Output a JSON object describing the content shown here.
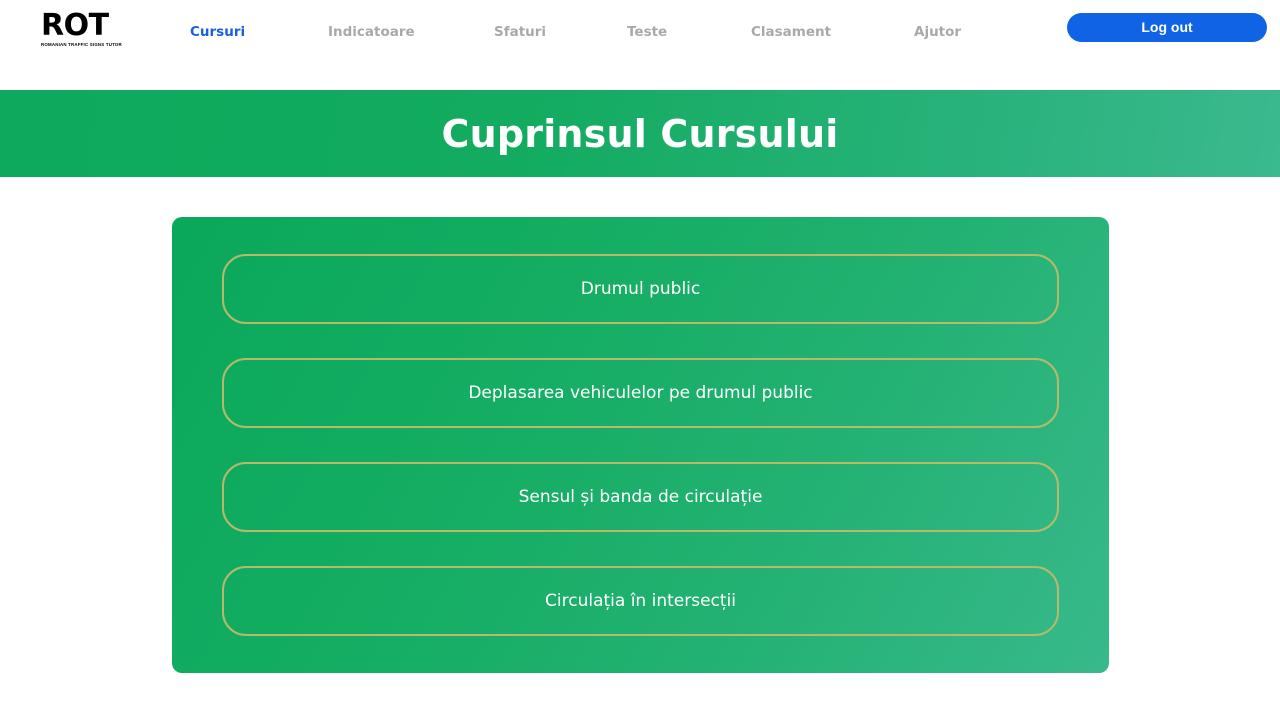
{
  "logo": {
    "mark": "ROT",
    "tagline": "ROMANIAN TRAFFIC SIGNS TUTOR"
  },
  "nav": {
    "items": [
      {
        "label": "Cursuri",
        "active": true
      },
      {
        "label": "Indicatoare",
        "active": false
      },
      {
        "label": "Sfaturi",
        "active": false
      },
      {
        "label": "Teste",
        "active": false
      },
      {
        "label": "Clasament",
        "active": false
      },
      {
        "label": "Ajutor",
        "active": false
      }
    ],
    "logout_label": "Log out"
  },
  "hero": {
    "title": "Cuprinsul Cursului"
  },
  "course": {
    "chapters": [
      {
        "label": "Drumul public"
      },
      {
        "label": "Deplasarea vehiculelor pe drumul public"
      },
      {
        "label": "Sensul și banda de circulație"
      },
      {
        "label": "Circulația în intersecții"
      }
    ]
  },
  "colors": {
    "accent_nav": "#1a5fe0",
    "logout_button": "#1163e6",
    "banner_green": "#0ea95c",
    "card_green": "#14ad62",
    "chapter_border": "#b8b96a",
    "inactive_nav": "#a9a9a9"
  }
}
